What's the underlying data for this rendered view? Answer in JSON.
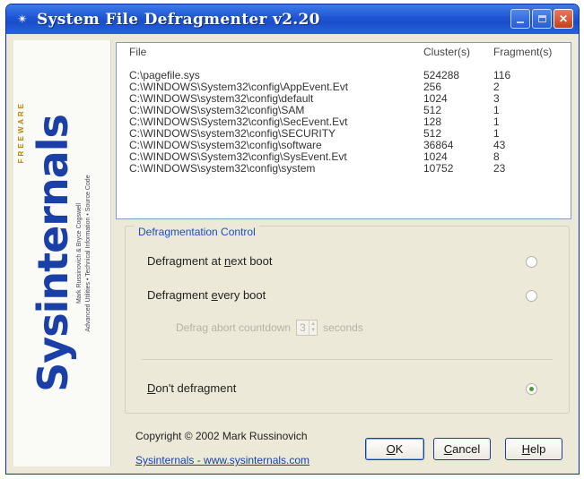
{
  "window": {
    "title": "System File Defragmenter v2.20",
    "app_icon": "defrag-app-icon"
  },
  "logo": {
    "brand": "Sysinternals",
    "freeware": "FREEWARE",
    "tagline1": "Mark Russinovich & Bryce Cogswell",
    "tagline2": "Advanced Utilities • Technical Information • Source Code"
  },
  "file_list": {
    "columns": [
      "File",
      "Cluster(s)",
      "Fragment(s)"
    ],
    "rows": [
      {
        "file": "C:\\pagefile.sys",
        "clusters": "524288",
        "fragments": "116"
      },
      {
        "file": "C:\\WINDOWS\\System32\\config\\AppEvent.Evt",
        "clusters": "256",
        "fragments": "2"
      },
      {
        "file": "C:\\WINDOWS\\system32\\config\\default",
        "clusters": "1024",
        "fragments": "3"
      },
      {
        "file": "C:\\WINDOWS\\system32\\config\\SAM",
        "clusters": "512",
        "fragments": "1"
      },
      {
        "file": "C:\\WINDOWS\\System32\\config\\SecEvent.Evt",
        "clusters": "128",
        "fragments": "1"
      },
      {
        "file": "C:\\WINDOWS\\system32\\config\\SECURITY",
        "clusters": "512",
        "fragments": "1"
      },
      {
        "file": "C:\\WINDOWS\\system32\\config\\software",
        "clusters": "36864",
        "fragments": "43"
      },
      {
        "file": "C:\\WINDOWS\\System32\\config\\SysEvent.Evt",
        "clusters": "1024",
        "fragments": "8"
      },
      {
        "file": "C:\\WINDOWS\\system32\\config\\system",
        "clusters": "10752",
        "fragments": "23"
      }
    ]
  },
  "control": {
    "legend": "Defragmentation Control",
    "opt_next_boot": {
      "pre": "Defragment at ",
      "u": "n",
      "post": "ext boot"
    },
    "opt_every_boot": {
      "pre": "Defragment ",
      "u": "e",
      "post": "very boot"
    },
    "countdown_label": "Defrag abort countdown",
    "countdown_value": "3",
    "countdown_unit": "seconds",
    "opt_dont": {
      "pre": "",
      "u": "D",
      "post": "on't defragment"
    },
    "selected": "dont"
  },
  "footer": {
    "copyright": "Copyright © 2002 Mark Russinovich",
    "link": "Sysinternals - www.sysinternals.com",
    "ok": {
      "u": "O",
      "post": "K"
    },
    "cancel": {
      "u": "C",
      "post": "ancel"
    },
    "help": {
      "u": "H",
      "post": "elp"
    }
  }
}
